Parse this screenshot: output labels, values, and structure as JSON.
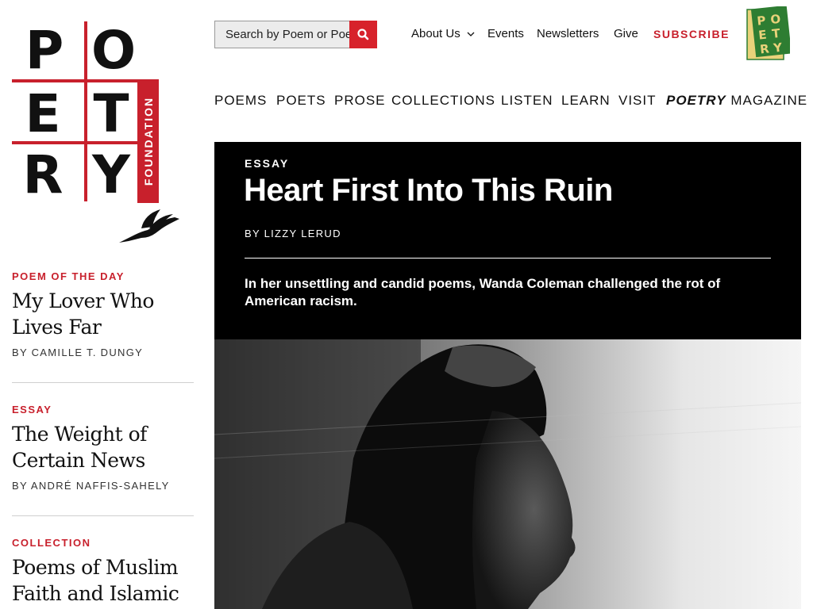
{
  "logo": {
    "letters": [
      "P",
      "O",
      "E",
      "T",
      "R",
      "Y"
    ],
    "side_label": "FOUNDATION",
    "accent": "#c8202c"
  },
  "search": {
    "placeholder": "Search by Poem or Poet"
  },
  "top_links": {
    "about": "About Us",
    "events": "Events",
    "newsletters": "Newsletters",
    "give": "Give",
    "subscribe": "SUBSCRIBE"
  },
  "magazine_badge": {
    "letters": [
      "P",
      "O",
      "E",
      "T",
      "R",
      "Y"
    ]
  },
  "main_nav": {
    "poems": "POEMS",
    "poets": "POETS",
    "prose": "PROSE",
    "collections": "COLLECTIONS",
    "listen": "LISTEN",
    "learn": "LEARN",
    "visit": "VISIT",
    "magazine_em": "POETRY",
    "magazine": "MAGAZINE"
  },
  "sidebar": {
    "items": [
      {
        "kicker": "POEM OF THE DAY",
        "title": "My Lover Who Lives Far",
        "byline": "BY CAMILLE T. DUNGY"
      },
      {
        "kicker": "ESSAY",
        "title": "The Weight of Certain News",
        "byline": "BY ANDRÉ NAFFIS-SAHELY"
      },
      {
        "kicker": "COLLECTION",
        "title": "Poems of Muslim Faith and Islamic"
      }
    ]
  },
  "hero": {
    "kicker": "ESSAY",
    "title": "Heart First Into This Ruin",
    "byline": "BY LIZZY LERUD",
    "dek": "In her unsettling and candid poems, Wanda Coleman challenged the rot of American racism."
  },
  "colors": {
    "accent_red": "#c8202c",
    "search_button": "#d7222b",
    "hero_bg": "#000000",
    "badge_green": "#2e7d32",
    "badge_yellow": "#e9d27a"
  }
}
